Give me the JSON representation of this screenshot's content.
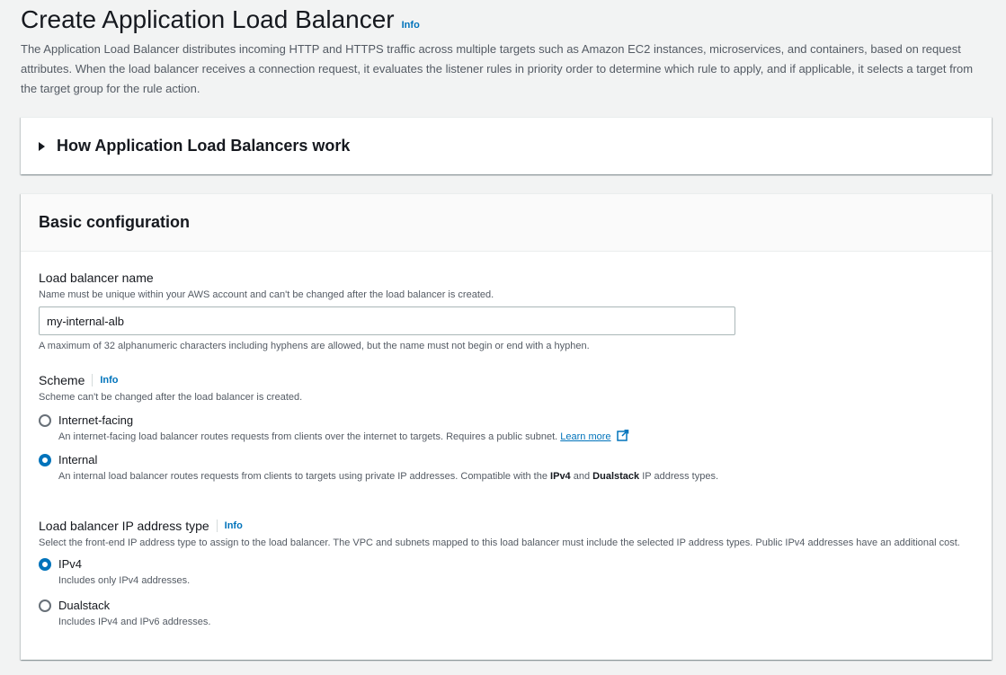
{
  "header": {
    "title": "Create Application Load Balancer",
    "info": "Info",
    "description": "The Application Load Balancer distributes incoming HTTP and HTTPS traffic across multiple targets such as Amazon EC2 instances, microservices, and containers, based on request attributes. When the load balancer receives a connection request, it evaluates the listener rules in priority order to determine which rule to apply, and if applicable, it selects a target from the target group for the rule action."
  },
  "how_it_works": {
    "title": "How Application Load Balancers work"
  },
  "basic_config": {
    "title": "Basic configuration",
    "name_field": {
      "label": "Load balancer name",
      "description": "Name must be unique within your AWS account and can't be changed after the load balancer is created.",
      "value": "my-internal-alb",
      "constraint": "A maximum of 32 alphanumeric characters including hyphens are allowed, but the name must not begin or end with a hyphen."
    },
    "scheme": {
      "label": "Scheme",
      "info": "Info",
      "description": "Scheme can't be changed after the load balancer is created.",
      "options": [
        {
          "label": "Internet-facing",
          "description": "An internet-facing load balancer routes requests from clients over the internet to targets. Requires a public subnet.",
          "learn_more": "Learn more",
          "checked": false
        },
        {
          "label": "Internal",
          "description_pre": "An internal load balancer routes requests from clients to targets using private IP addresses. Compatible with the",
          "bold1": "IPv4",
          "and": "and",
          "bold2": "Dualstack",
          "description_post": "IP address types.",
          "checked": true
        }
      ]
    },
    "ip_type": {
      "label": "Load balancer IP address type",
      "info": "Info",
      "description": "Select the front-end IP address type to assign to the load balancer. The VPC and subnets mapped to this load balancer must include the selected IP address types. Public IPv4 addresses have an additional cost.",
      "options": [
        {
          "label": "IPv4",
          "description": "Includes only IPv4 addresses.",
          "checked": true
        },
        {
          "label": "Dualstack",
          "description": "Includes IPv4 and IPv6 addresses.",
          "checked": false
        }
      ]
    }
  },
  "colors": {
    "accent": "#0073bb",
    "background": "#f2f3f3",
    "text": "#16191f",
    "muted": "#545b64"
  }
}
